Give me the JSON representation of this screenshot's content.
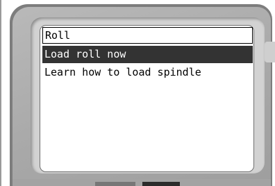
{
  "menu": {
    "title": "Roll",
    "items": [
      {
        "label": "Load roll now",
        "selected": true
      },
      {
        "label": "Learn how to load spindle",
        "selected": false
      }
    ]
  },
  "colors": {
    "selected_bg": "#333333",
    "selected_text": "#ffffff",
    "bezel": "#a8a8a8"
  }
}
